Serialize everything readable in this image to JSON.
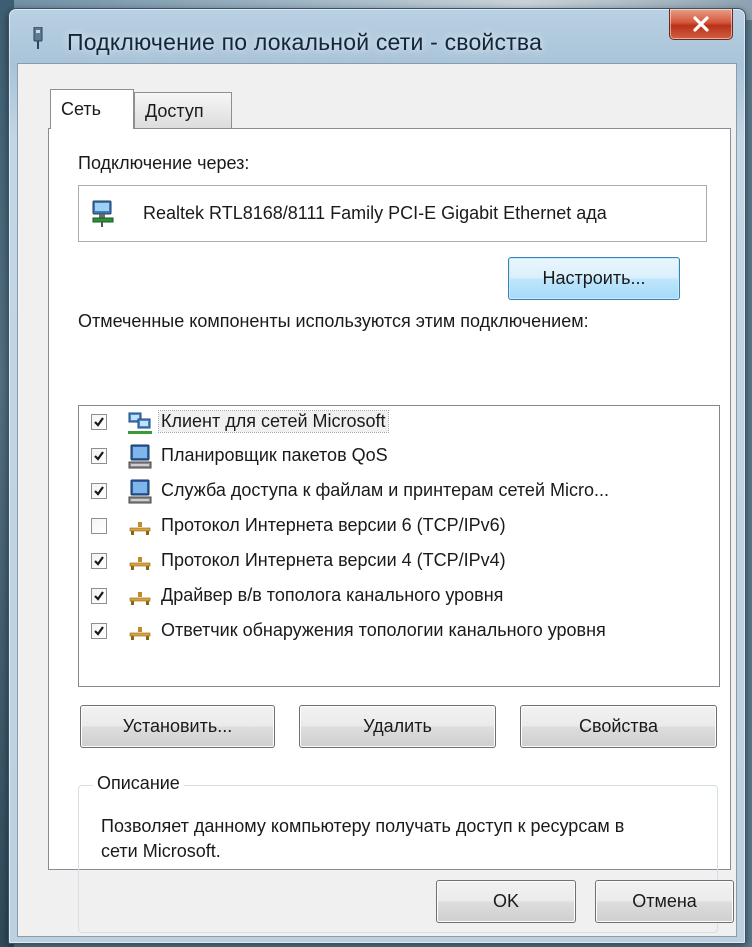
{
  "window": {
    "title": "Подключение по локальной сети - свойства",
    "close_glyph": "x"
  },
  "tabs": [
    {
      "label": "Сеть",
      "selected": true
    },
    {
      "label": "Доступ",
      "selected": false
    }
  ],
  "connection": {
    "label": "Подключение через:",
    "adapter_name": "Realtek RTL8168/8111 Family PCI-E Gigabit Ethernet ада",
    "adapter_icon": "network-adapter-icon",
    "configure_button": "Настроить..."
  },
  "components": {
    "label": "Отмеченные компоненты используются этим подключением:",
    "items": [
      {
        "label": "Клиент для сетей Microsoft",
        "checked": true,
        "icon": "network-client-icon",
        "selected": true
      },
      {
        "label": "Планировщик пакетов QoS",
        "checked": true,
        "icon": "service-computer-icon",
        "selected": false
      },
      {
        "label": "Служба доступа к файлам и принтерам сетей Micro...",
        "checked": true,
        "icon": "service-computer-icon",
        "selected": false
      },
      {
        "label": "Протокол Интернета версии 6 (TCP/IPv6)",
        "checked": false,
        "icon": "protocol-icon",
        "selected": false
      },
      {
        "label": "Протокол Интернета версии 4 (TCP/IPv4)",
        "checked": true,
        "icon": "protocol-icon",
        "selected": false
      },
      {
        "label": "Драйвер в/в тополога канального уровня",
        "checked": true,
        "icon": "protocol-icon",
        "selected": false
      },
      {
        "label": "Ответчик обнаружения топологии канального уровня",
        "checked": true,
        "icon": "protocol-icon",
        "selected": false
      }
    ]
  },
  "actions": {
    "install": "Установить...",
    "remove": "Удалить",
    "properties": "Свойства"
  },
  "description": {
    "legend": "Описание",
    "text": "Позволяет данному компьютеру получать доступ к ресурсам в сети Microsoft."
  },
  "footer": {
    "ok": "OK",
    "cancel": "Отмена"
  },
  "colors": {
    "accent_button_border": "#3c7fb1",
    "close_button": "#c8442a",
    "panel_background": "#ffffff",
    "dialog_background": "#f0f0f0"
  }
}
